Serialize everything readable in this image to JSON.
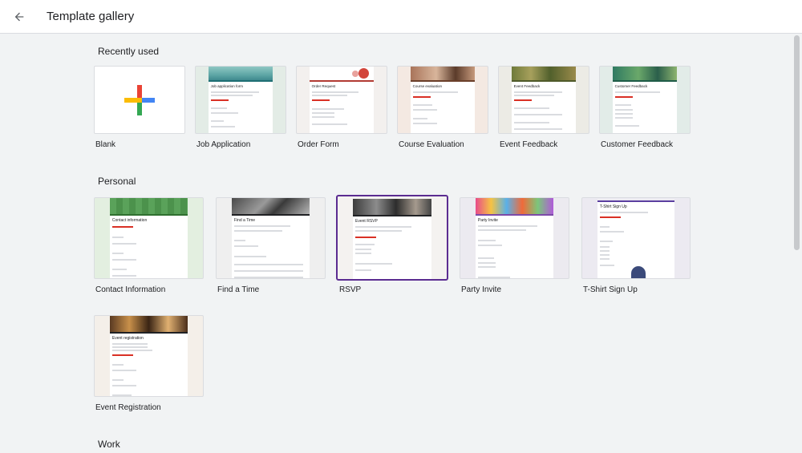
{
  "header": {
    "title": "Template gallery",
    "back_icon": "arrow-back-icon"
  },
  "sections": {
    "recent": "Recently used",
    "personal": "Personal",
    "work": "Work"
  },
  "templates": {
    "blank": {
      "label": "Blank"
    },
    "job_application": {
      "label": "Job Application",
      "preview_title": "Job application form"
    },
    "order_form": {
      "label": "Order Form",
      "preview_title": "Order Request"
    },
    "course_evaluation": {
      "label": "Course Evaluation",
      "preview_title": "Course evaluation"
    },
    "event_feedback": {
      "label": "Event Feedback",
      "preview_title": "Event Feedback"
    },
    "customer_feedback": {
      "label": "Customer Feedback",
      "preview_title": "Customer Feedback"
    },
    "contact_information": {
      "label": "Contact Information",
      "preview_title": "Contact information"
    },
    "find_a_time": {
      "label": "Find a Time",
      "preview_title": "Find a Time"
    },
    "rsvp": {
      "label": "RSVP",
      "preview_title": "Event RSVP"
    },
    "party_invite": {
      "label": "Party Invite",
      "preview_title": "Party Invite"
    },
    "tshirt_signup": {
      "label": "T-Shirt Sign Up",
      "preview_title": "T-Shirt Sign Up"
    },
    "event_registration": {
      "label": "Event Registration",
      "preview_title": "Event registration"
    }
  },
  "colors": {
    "selected_border": "#5b2c91",
    "google_red": "#ea4335",
    "google_blue": "#4285f4",
    "google_green": "#34a853",
    "google_yellow": "#fbbc04"
  }
}
